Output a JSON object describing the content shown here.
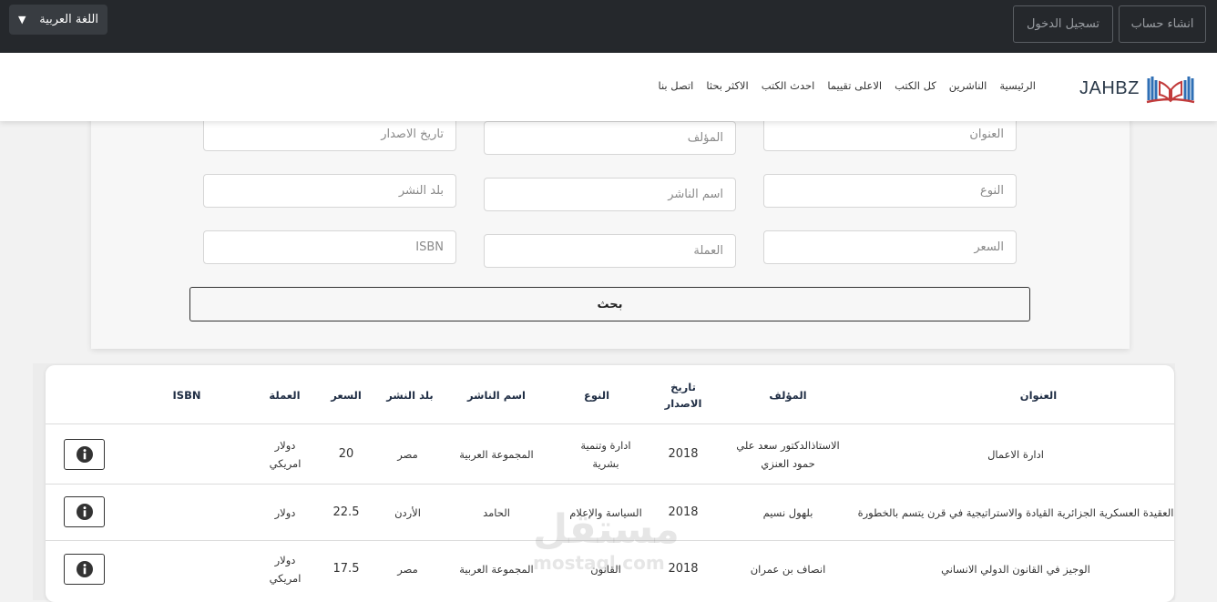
{
  "topbar": {
    "language_label": "اللغة العربية",
    "login_label": "تسجيل الدخول",
    "register_label": "انشاء حساب"
  },
  "navbar": {
    "brand": "JAHBZ",
    "items": [
      "الرئيسية",
      "الناشرين",
      "كل الكتب",
      "الاعلى تقييما",
      "احدث الكتب",
      "الاكثر بحثا",
      "اتصل بنا"
    ]
  },
  "search": {
    "title_placeholder": "العنوان",
    "author_placeholder": "المؤلف",
    "date_placeholder": "تاريخ الاصدار",
    "type_placeholder": "النوع",
    "publisher_placeholder": "اسم الناشر",
    "country_placeholder": "بلد النشر",
    "price_placeholder": "السعر",
    "currency_placeholder": "العملة",
    "isbn_placeholder": "ISBN",
    "button_label": "بحث"
  },
  "table": {
    "headers": {
      "title": "العنوان",
      "author": "المؤلف",
      "date_line1": "تاريخ",
      "date_line2": "الاصدار",
      "type": "النوع",
      "publisher": "اسم الناشر",
      "country": "بلد النشر",
      "price": "السعر",
      "currency": "العملة",
      "isbn": "ISBN"
    },
    "rows": [
      {
        "title": "ادارة الاعمال",
        "author_l1": "الاستاذالدكتور سعد علي",
        "author_l2": "حمود العنزي",
        "date": "2018",
        "type_l1": "ادارة وتنمية",
        "type_l2": "بشرية",
        "publisher": "المجموعة العربية",
        "country": "مصر",
        "price": "20",
        "currency_l1": "دولار",
        "currency_l2": "امريكي",
        "isbn": ""
      },
      {
        "title": "العقيدة العسكرية الجزائرية القيادة والاستراتيجية في قرن يتسم بالخطورة",
        "author_l1": "بلهول نسيم",
        "author_l2": "",
        "date": "2018",
        "type_l1": "السياسة والإعلام",
        "type_l2": "",
        "publisher": "الحامد",
        "country": "الأردن",
        "price": "22.5",
        "currency_l1": "دولار",
        "currency_l2": "",
        "isbn": ""
      },
      {
        "title": "الوجيز في القانون الدولي الانساني",
        "author_l1": "انصاف بن عمران",
        "author_l2": "",
        "date": "2018",
        "type_l1": "القانون",
        "type_l2": "",
        "publisher": "المجموعة العربية",
        "country": "مصر",
        "price": "17.5",
        "currency_l1": "دولار",
        "currency_l2": "امريكي",
        "isbn": ""
      }
    ]
  },
  "watermark": {
    "text": "مستقل",
    "sub": "mostaql.com"
  },
  "colors": {
    "topbar_bg": "#25282c",
    "header_text": "#1f2d44",
    "logo_blue": "#2f6fb5",
    "logo_red": "#c23b3b"
  }
}
